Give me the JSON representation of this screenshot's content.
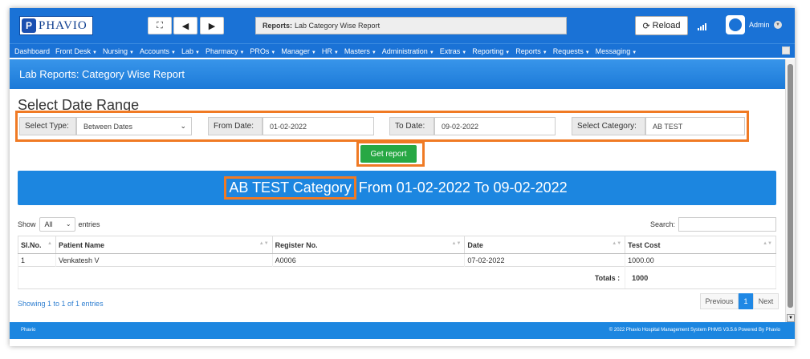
{
  "app": {
    "logo_letter": "P",
    "logo_text": "PHAVIO"
  },
  "toolbar": {
    "fullscreen_icon": "expand-icon",
    "back_icon": "arrow-left-icon",
    "forward_icon": "arrow-right-icon",
    "report_prefix": "Reports:",
    "report_name": "Lab Category Wise Report",
    "reload_label": "Reload",
    "user_name": "Admin"
  },
  "nav": [
    {
      "label": "Dashboard",
      "has_menu": false
    },
    {
      "label": "Front Desk",
      "has_menu": true
    },
    {
      "label": "Nursing",
      "has_menu": true
    },
    {
      "label": "Accounts",
      "has_menu": true
    },
    {
      "label": "Lab",
      "has_menu": true
    },
    {
      "label": "Pharmacy",
      "has_menu": true
    },
    {
      "label": "PROs",
      "has_menu": true
    },
    {
      "label": "Manager",
      "has_menu": true
    },
    {
      "label": "HR",
      "has_menu": true
    },
    {
      "label": "Masters",
      "has_menu": true
    },
    {
      "label": "Administration",
      "has_menu": true
    },
    {
      "label": "Extras",
      "has_menu": true
    },
    {
      "label": "Reporting",
      "has_menu": true
    },
    {
      "label": "Reports",
      "has_menu": true
    },
    {
      "label": "Requests",
      "has_menu": true
    },
    {
      "label": "Messaging",
      "has_menu": true
    }
  ],
  "page": {
    "header": "Lab Reports: Category Wise Report",
    "title": "Select Date Range"
  },
  "filters": {
    "select_type_label": "Select Type:",
    "select_type_value": "Between Dates",
    "from_label": "From Date:",
    "from_value": "01-02-2022",
    "to_label": "To Date:",
    "to_value": "09-02-2022",
    "category_label": "Select Category:",
    "category_value": "AB TEST",
    "get_report": "Get report"
  },
  "banner": {
    "category": "AB TEST Category",
    "range": "From 01-02-2022 To 09-02-2022"
  },
  "table_controls": {
    "show_label": "Show",
    "show_value": "All",
    "entries_label": "entries",
    "search_label": "Search:"
  },
  "table": {
    "columns": [
      "Sl.No.",
      "Patient Name",
      "Register No.",
      "Date",
      "Test Cost"
    ],
    "rows": [
      [
        "1",
        "Venkatesh V",
        "A0006",
        "07-02-2022",
        "1000.00"
      ]
    ],
    "totals_label": "Totals :",
    "totals_value": "1000"
  },
  "pagination": {
    "info": "Showing 1 to 1 of 1 entries",
    "previous": "Previous",
    "current": "1",
    "next": "Next"
  },
  "footer": {
    "left": "Phavio",
    "right": "© 2022 Phavio Hospital Management System PHMS V3.5.6 Powered By Phavio"
  },
  "colors": {
    "primary": "#1a72d6",
    "accent": "#f07a24",
    "success": "#27a844"
  }
}
